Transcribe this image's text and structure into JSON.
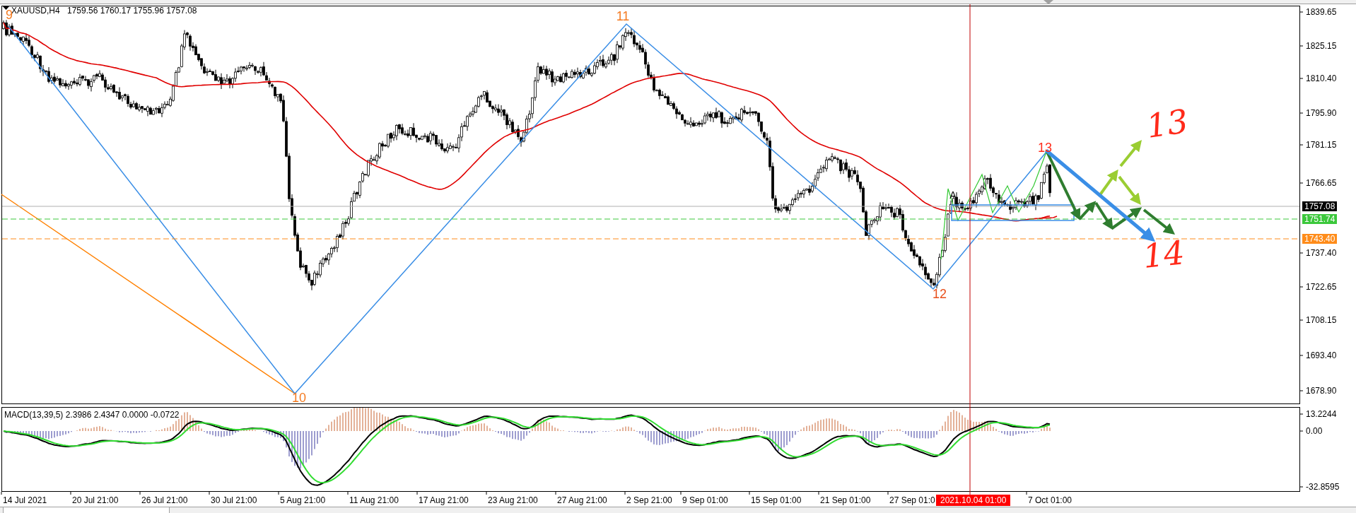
{
  "chart": {
    "symbol": "XAUUSD,H4",
    "ohlc": "1759.56 1760.17 1755.96 1757.08",
    "wave_labels": [
      {
        "text": "9",
        "color": "#f47a20"
      },
      {
        "text": "10",
        "color": "#f47a20"
      },
      {
        "text": "11",
        "color": "#f47a20"
      },
      {
        "text": "12",
        "color": "#e8501c"
      },
      {
        "text": "13",
        "color": "#ff2a1a"
      }
    ],
    "point_label": "A",
    "handwritten": [
      {
        "text": "13"
      },
      {
        "text": "14"
      }
    ],
    "price_axis": [
      "1839.65",
      "1825.15",
      "1810.40",
      "1795.90",
      "1781.15",
      "1766.65",
      "1737.40",
      "1722.65",
      "1708.15",
      "1693.40",
      "1678.90"
    ],
    "price_markers": [
      {
        "text": "1757.08",
        "color": "#000000"
      },
      {
        "text": "1751.74",
        "color": "#3cc83c"
      },
      {
        "text": "1743.40",
        "color": "#ff8c1a"
      }
    ]
  },
  "macd": {
    "label": "MACD(13,39,5) 2.3986 2.4347 0.0000 -0.0722",
    "axis": [
      "13.2244",
      "0.00",
      "-32.8595"
    ]
  },
  "time_axis": {
    "labels": [
      "14 Jul 2021",
      "20 Jul 21:00",
      "26 Jul 21:00",
      "30 Jul 21:00",
      "5 Aug 21:00",
      "11 Aug 21:00",
      "17 Aug 21:00",
      "23 Aug 21:00",
      "27 Aug 21:00",
      "2 Sep 21:00",
      "9 Sep 01:00",
      "15 Sep 01:00",
      "21 Sep 01:00",
      "27 Sep 01:0",
      "7 Oct 01:00"
    ],
    "crosshair_label": "2021.10.04 01:00"
  }
}
